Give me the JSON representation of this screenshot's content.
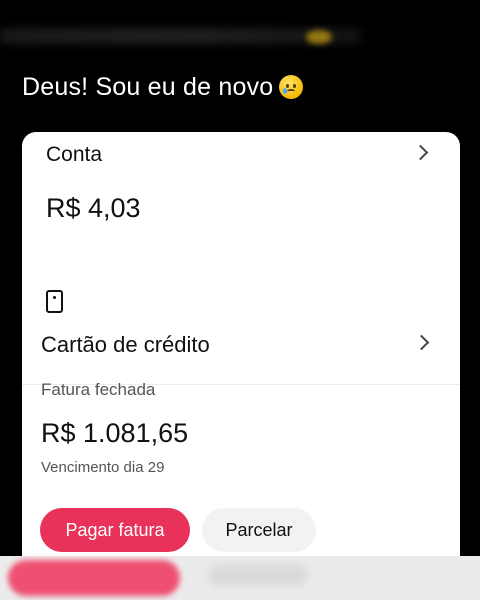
{
  "caption": {
    "text": "Deus! Sou eu de novo",
    "emoji": "crying-face-icon"
  },
  "account": {
    "title": "Conta",
    "balance": "R$ 4,03"
  },
  "credit_card": {
    "icon": "card-icon",
    "title": "Cartão de crédito",
    "status": "Fatura fechada",
    "amount": "R$ 1.081,65",
    "due": "Vencimento dia 29",
    "pay_label": "Pagar fatura",
    "installments_label": "Parcelar"
  },
  "colors": {
    "accent": "#e8325a",
    "background": "#000000",
    "card": "#ffffff"
  }
}
